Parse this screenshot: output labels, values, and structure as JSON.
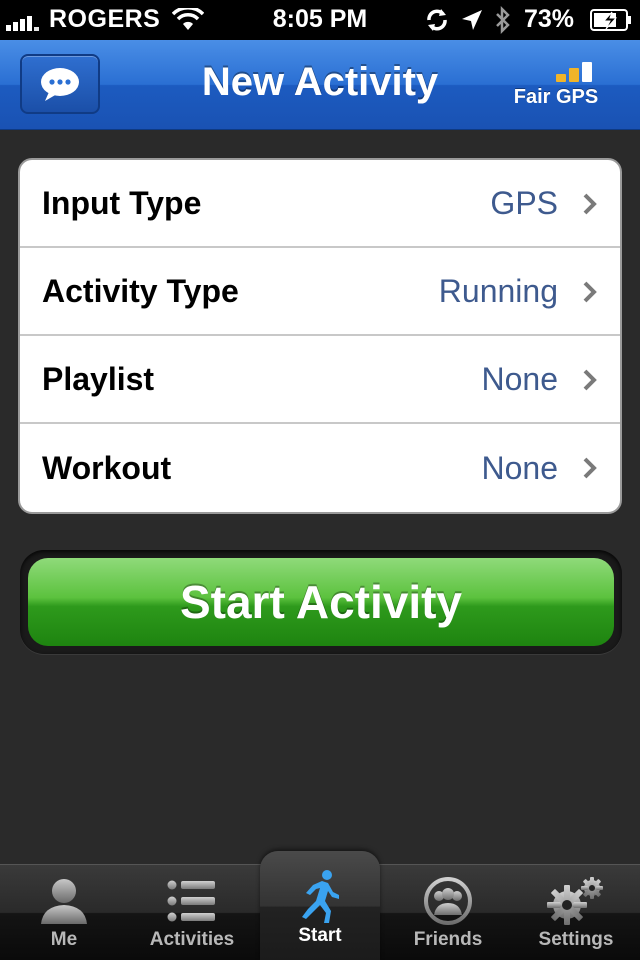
{
  "status_bar": {
    "carrier": "ROGERS",
    "time": "8:05 PM",
    "battery_percent": "73%"
  },
  "nav": {
    "title": "New Activity",
    "gps_label": "Fair GPS",
    "gps_bar_color": "#f0b429",
    "gps_bar_empty_color": "#ffffff"
  },
  "settings": [
    {
      "label": "Input Type",
      "value": "GPS"
    },
    {
      "label": "Activity Type",
      "value": "Running"
    },
    {
      "label": "Playlist",
      "value": "None"
    },
    {
      "label": "Workout",
      "value": "None"
    }
  ],
  "start_button": {
    "label": "Start Activity",
    "color": "#2e9a1c"
  },
  "tabs": [
    {
      "label": "Me",
      "icon": "person-icon"
    },
    {
      "label": "Activities",
      "icon": "list-icon"
    },
    {
      "label": "Start",
      "icon": "runner-icon",
      "active": true
    },
    {
      "label": "Friends",
      "icon": "friends-icon"
    },
    {
      "label": "Settings",
      "icon": "gears-icon"
    }
  ],
  "colors": {
    "nav_blue": "#2a6fd3",
    "value_text": "#3e5a8e",
    "runner_blue": "#3aa3f0"
  }
}
